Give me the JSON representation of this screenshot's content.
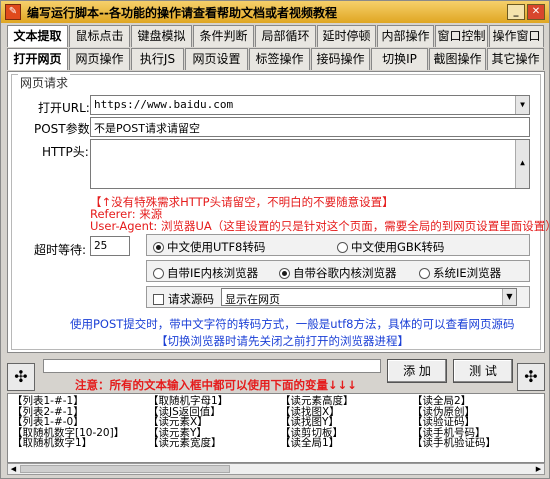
{
  "window": {
    "title": "编写运行脚本--各功能的操作请查看帮助文档或者视频教程"
  },
  "tabs_row1": [
    "文本提取",
    "鼠标点击",
    "键盘模拟",
    "条件判断",
    "局部循环",
    "延时停顿",
    "内部操作",
    "窗口控制",
    "操作窗口"
  ],
  "tabs_row2": [
    "打开网页",
    "网页操作",
    "执行JS",
    "网页设置",
    "标签操作",
    "接码操作",
    "切换IP",
    "截图操作",
    "其它操作"
  ],
  "group_title": "网页请求",
  "url": {
    "label": "打开URL:",
    "value": "https://www.baidu.com"
  },
  "post": {
    "label": "POST参数:",
    "value": "不是POST请求请留空"
  },
  "http": {
    "label": "HTTP头:",
    "value": ""
  },
  "notes": {
    "line1": "【↑没有特殊需求HTTP头请留空，不明白的不要随意设置】",
    "line2": "Referer: 来源",
    "line3": "User-Agent: 浏览器UA（这里设置的只是针对这个页面，需要全局的到网页设置里面设置）"
  },
  "timeout": {
    "label": "超时等待:",
    "value": "25"
  },
  "encoding": {
    "utf8": "中文使用UTF8转码",
    "gbk": "中文使用GBK转码",
    "selected": "utf8"
  },
  "browser": {
    "ie": "自带IE内核浏览器",
    "chrome": "自带谷歌内核浏览器",
    "system": "系统IE浏览器",
    "selected": "chrome"
  },
  "source": {
    "checkbox_label": "请求源码",
    "display": "显示在网页"
  },
  "hint1": "使用POST提交时，带中文字符的转码方式，一般是utf8方法，具体的可以查看网页源码",
  "hint2": "【切换浏览器时请先关闭之前打开的浏览器进程】",
  "buttons": {
    "add": "添 加",
    "test": "测 试"
  },
  "var_note": "注意：所有的文本输入框中都可以使用下面的变量↓↓↓",
  "variables": [
    [
      "【列表1-#-1】",
      "【列表2-#-1】",
      "【列表1-#-0】",
      "【取随机数字[10-20]】",
      "【取随机数字1】"
    ],
    [
      "【取随机字母1】",
      "【读JS返回值】",
      "【读元素X】",
      "【读元素Y】",
      "【读元素宽度】"
    ],
    [
      "【读元素高度】",
      "【读找图X】",
      "【读找图Y】",
      "【读剪切板】",
      "【读全局1】"
    ],
    [
      "【读全局2】",
      "【读伪原创】",
      "【读验证码】",
      "【读手机号码】",
      "【读手机验证码】"
    ]
  ],
  "colors": {
    "title_bg": "#e8b33a",
    "red": "#e51c1c",
    "blue": "#1a3fd6"
  }
}
